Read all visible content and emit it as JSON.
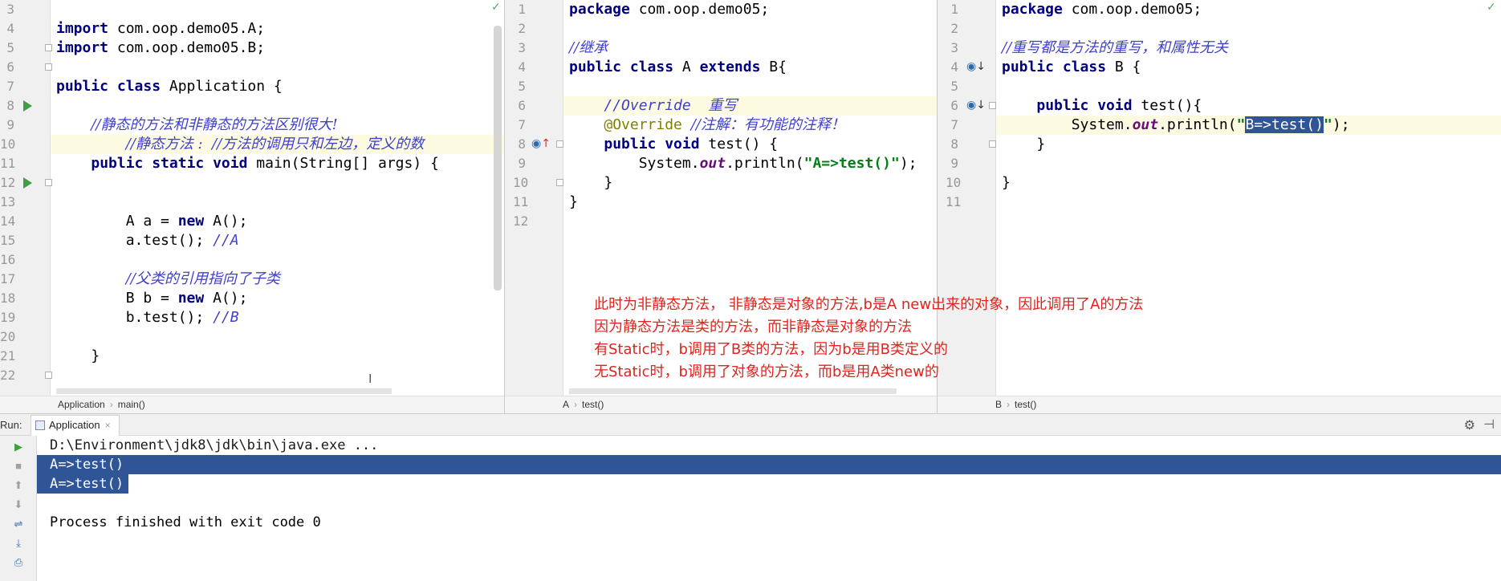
{
  "editors": {
    "application": {
      "lines": [
        {
          "n": "3",
          "t": ""
        },
        {
          "n": "4",
          "t": "import com.oop.demo05.A;"
        },
        {
          "n": "5",
          "t": "import com.oop.demo05.B;"
        },
        {
          "n": "6",
          "t": ""
        },
        {
          "n": "7",
          "t": "public class Application {"
        },
        {
          "n": "8",
          "t": ""
        },
        {
          "n": "9",
          "t": "    //静态的方法和非静态的方法区别很大!"
        },
        {
          "n": "10",
          "t": "        //静态方法 :  //方法的调用只和左边，定义的数"
        },
        {
          "n": "11",
          "t": "    public static void main(String[] args) {"
        },
        {
          "n": "12",
          "t": ""
        },
        {
          "n": "13",
          "t": ""
        },
        {
          "n": "14",
          "t": "        A a = new A();"
        },
        {
          "n": "15",
          "t": "        a.test(); //A"
        },
        {
          "n": "16",
          "t": ""
        },
        {
          "n": "17",
          "t": "        //父类的引用指向了子类"
        },
        {
          "n": "18",
          "t": "        B b = new A();"
        },
        {
          "n": "19",
          "t": "        b.test(); //B"
        },
        {
          "n": "20",
          "t": ""
        },
        {
          "n": "21",
          "t": "    }"
        },
        {
          "n": "22",
          "t": ""
        }
      ],
      "breadcrumb": [
        "Application",
        "main()"
      ]
    },
    "classA": {
      "lines": [
        {
          "n": "1",
          "t": "package com.oop.demo05;"
        },
        {
          "n": "2",
          "t": ""
        },
        {
          "n": "3",
          "t": "//继承"
        },
        {
          "n": "4",
          "t": "public class A extends B{"
        },
        {
          "n": "5",
          "t": ""
        },
        {
          "n": "6",
          "t": "    //Override  重写"
        },
        {
          "n": "7",
          "t": "    @Override //注解：有功能的注释！"
        },
        {
          "n": "8",
          "t": "    public void test() {"
        },
        {
          "n": "9",
          "t": "        System.out.println(\"A=>test()\");"
        },
        {
          "n": "10",
          "t": "    }"
        },
        {
          "n": "11",
          "t": "}"
        },
        {
          "n": "12",
          "t": ""
        }
      ],
      "breadcrumb": [
        "A",
        "test()"
      ]
    },
    "classB": {
      "lines": [
        {
          "n": "1",
          "t": "package com.oop.demo05;"
        },
        {
          "n": "2",
          "t": ""
        },
        {
          "n": "3",
          "t": "//重写都是方法的重写，和属性无关"
        },
        {
          "n": "4",
          "t": "public class B {"
        },
        {
          "n": "5",
          "t": ""
        },
        {
          "n": "6",
          "t": "    public void test(){"
        },
        {
          "n": "7",
          "t": "        System.out.println(\"B=>test()\");"
        },
        {
          "n": "8",
          "t": "    }"
        },
        {
          "n": "9",
          "t": ""
        },
        {
          "n": "10",
          "t": "}"
        },
        {
          "n": "11",
          "t": ""
        }
      ],
      "breadcrumb": [
        "B",
        "test()"
      ]
    }
  },
  "annotation_note": [
    "此时为非静态方法， 非静态是对象的方法,b是A new出来的对象，因此调用了A的方法",
    "因为静态方法是类的方法，而非静态是对象的方法",
    "有Static时，b调用了B类的方法，因为b是用B类定义的",
    "无Static时，b调用了对象的方法，而b是用A类new的"
  ],
  "run_panel": {
    "label": "Run:",
    "tab_label": "Application",
    "tab_close": "×",
    "console_lines": [
      "D:\\Environment\\jdk8\\jdk\\bin\\java.exe ...",
      "A=>test()",
      "A=>test()",
      "",
      "Process finished with exit code 0"
    ]
  },
  "colors": {
    "keyword": "#000080",
    "comment": "#3f3fcf",
    "string": "#067d17",
    "annotation": "#808000",
    "selection": "#2f5597",
    "note_red": "#e0231f",
    "run_green": "#3f9f3f"
  }
}
